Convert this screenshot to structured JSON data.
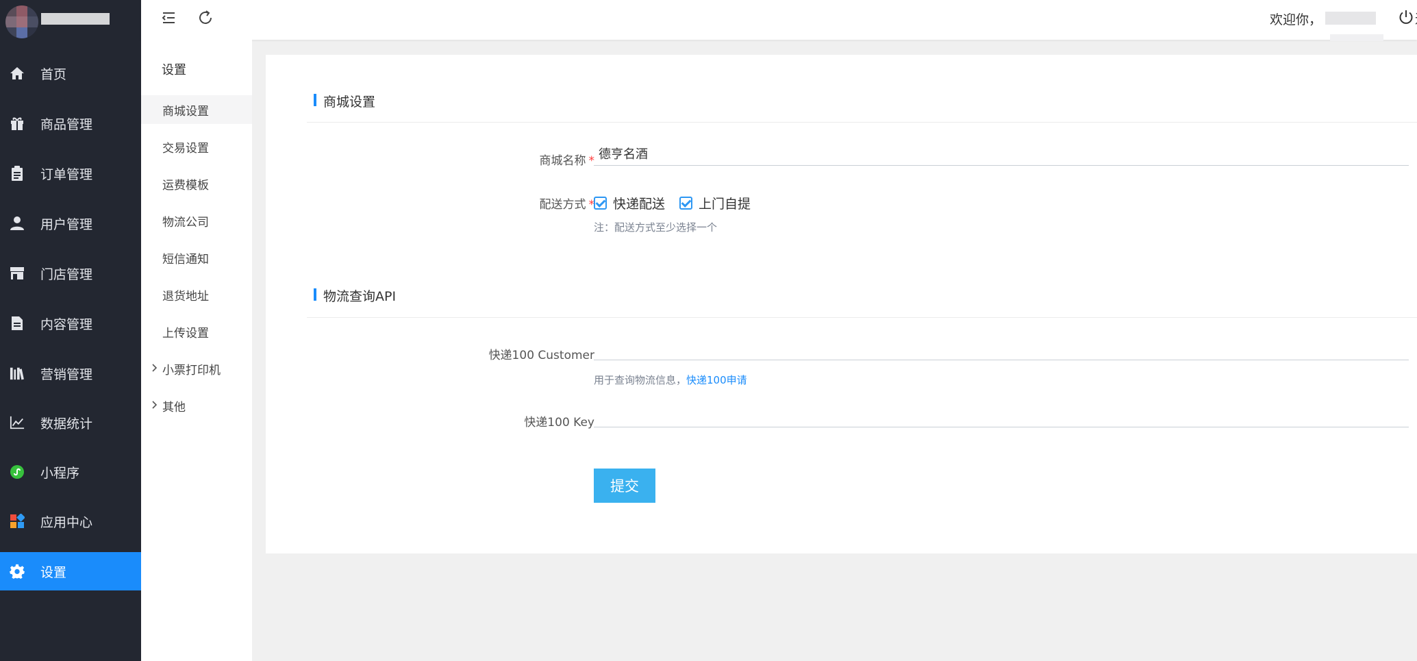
{
  "sidebar": {
    "items": [
      {
        "label": "首页",
        "icon": "home-icon"
      },
      {
        "label": "商品管理",
        "icon": "gift-icon"
      },
      {
        "label": "订单管理",
        "icon": "clipboard-icon"
      },
      {
        "label": "用户管理",
        "icon": "user-icon"
      },
      {
        "label": "门店管理",
        "icon": "store-icon"
      },
      {
        "label": "内容管理",
        "icon": "document-icon"
      },
      {
        "label": "营销管理",
        "icon": "books-icon"
      },
      {
        "label": "数据统计",
        "icon": "chart-line-icon"
      },
      {
        "label": "小程序",
        "icon": "mini-program-icon"
      },
      {
        "label": "应用中心",
        "icon": "apps-icon"
      },
      {
        "label": "设置",
        "icon": "gear-icon",
        "active": true
      }
    ]
  },
  "subnav": {
    "title": "设置",
    "items": [
      {
        "label": "商城设置",
        "active": true
      },
      {
        "label": "交易设置"
      },
      {
        "label": "运费模板"
      },
      {
        "label": "物流公司"
      },
      {
        "label": "短信通知"
      },
      {
        "label": "退货地址"
      },
      {
        "label": "上传设置"
      },
      {
        "label": "小票打印机",
        "expandable": true
      },
      {
        "label": "其他",
        "expandable": true
      }
    ]
  },
  "header": {
    "welcome": "欢迎你，",
    "logout_partial": "退"
  },
  "form": {
    "section1_title": "商城设置",
    "store_name_label": "商城名称",
    "store_name_value": "德亨名酒",
    "delivery_label": "配送方式",
    "required_mark": "*",
    "delivery_options": [
      {
        "label": "快递配送",
        "checked": true
      },
      {
        "label": "上门自提",
        "checked": true
      }
    ],
    "delivery_hint": "注：配送方式至少选择一个",
    "section2_title": "物流查询API",
    "customer_label": "快递100 Customer",
    "customer_value": "",
    "customer_hint": "用于查询物流信息，",
    "customer_hint_link": "快递100申请",
    "key_label": "快递100 Key",
    "key_value": "",
    "submit_label": "提交"
  },
  "colors": {
    "sidebar_bg": "#232731",
    "accent": "#1a8cfb",
    "button": "#3ab1ef",
    "required": "#ff3a3a"
  }
}
